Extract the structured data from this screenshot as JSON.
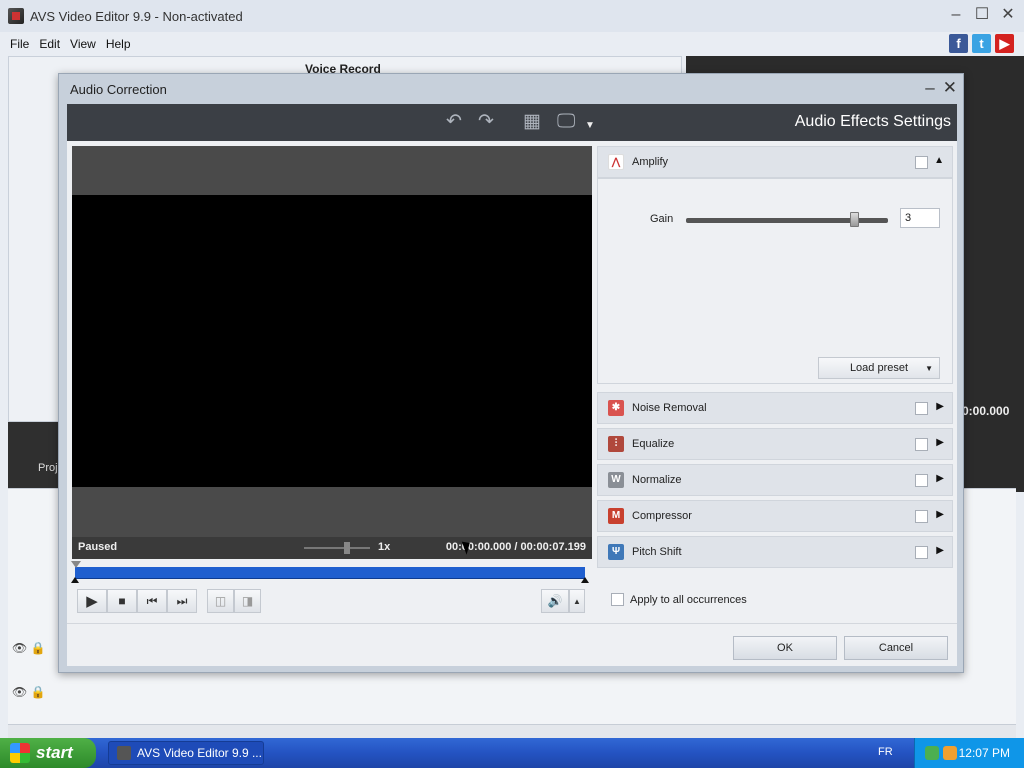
{
  "app": {
    "title": "AVS Video Editor 9.9 - Non-activated",
    "menu": [
      "File",
      "Edit",
      "View",
      "Help"
    ],
    "social": {
      "facebook": "f",
      "twitter": "t",
      "youtube": "▶"
    },
    "background": {
      "voice_record_label": "Voice Record",
      "right_time": "0:00.000",
      "strip_label": "Proj"
    }
  },
  "dialog": {
    "title": "Audio Correction",
    "toolbar_heading": "Audio Effects Settings",
    "player": {
      "status": "Paused",
      "speed": "1x",
      "current_time": "00:00:00.000",
      "separator": "/",
      "total_time": "00:00:07.199",
      "progress": 0.0
    },
    "effects": [
      {
        "name": "Amplify",
        "icon": "amplify-icon",
        "color": "#ffffff",
        "expanded": true,
        "checked": false
      },
      {
        "name": "Noise Removal",
        "icon": "noise-removal-icon",
        "color": "#d9534f",
        "expanded": false,
        "checked": false
      },
      {
        "name": "Equalize",
        "icon": "equalize-icon",
        "color": "#b0483c",
        "expanded": false,
        "checked": false
      },
      {
        "name": "Normalize",
        "icon": "normalize-icon",
        "color": "#8a8f96",
        "expanded": false,
        "checked": false
      },
      {
        "name": "Compressor",
        "icon": "compressor-icon",
        "color": "#c8402e",
        "expanded": false,
        "checked": false
      },
      {
        "name": "Pitch Shift",
        "icon": "pitch-shift-icon",
        "color": "#3f78b8",
        "expanded": false,
        "checked": false
      }
    ],
    "amplify": {
      "gain_label": "Gain",
      "gain_value": "3",
      "gain_fraction": 0.83,
      "load_preset_label": "Load preset"
    },
    "apply_all_label": "Apply to all occurrences",
    "ok_label": "OK",
    "cancel_label": "Cancel"
  },
  "taskbar": {
    "start_label": "start",
    "task_item": "AVS Video Editor 9.9 ...",
    "language": "FR",
    "clock": "12:07 PM"
  }
}
